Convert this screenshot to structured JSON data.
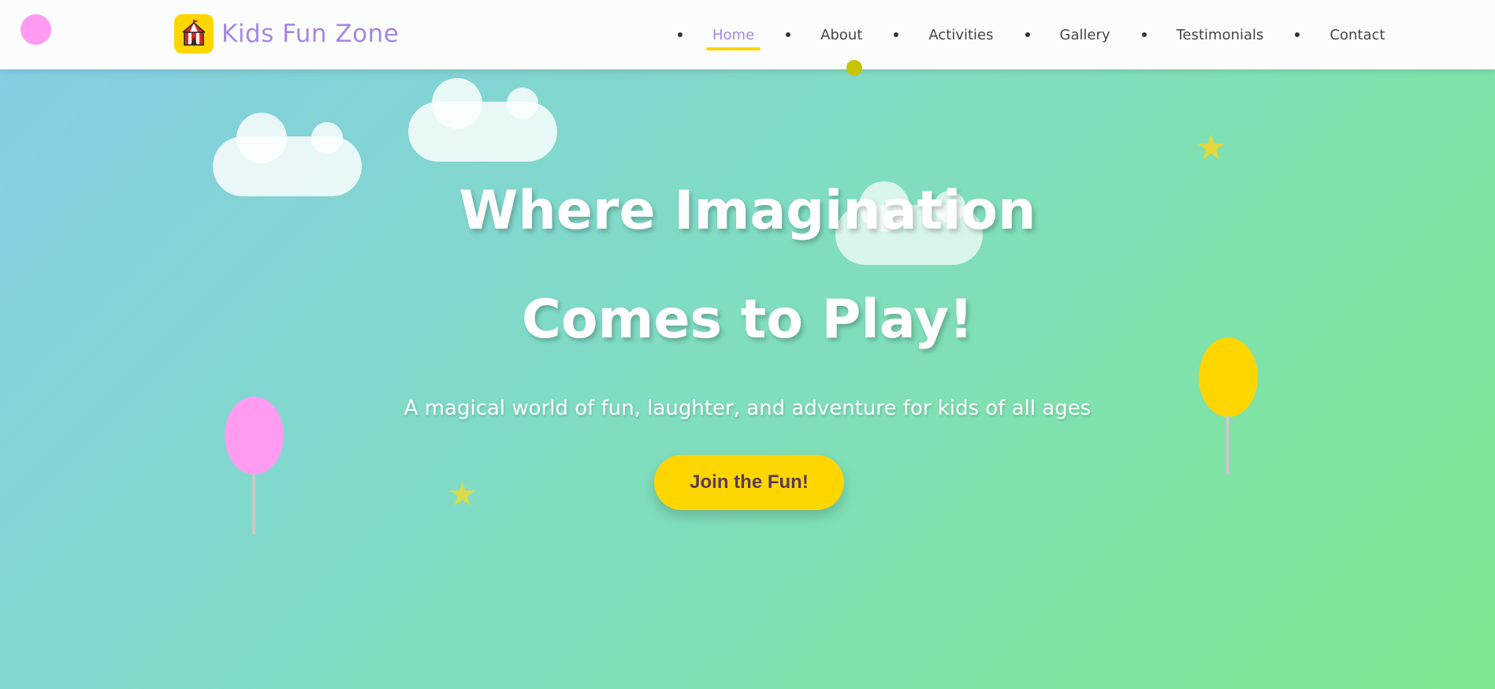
{
  "brand": {
    "name": "Kids Fun Zone",
    "logo_icon": "circus-tent-icon",
    "logo_bg_color": "#ffd600",
    "text_color": "#a488e3"
  },
  "nav": {
    "items": [
      {
        "label": "Home",
        "active": true
      },
      {
        "label": "About",
        "active": false
      },
      {
        "label": "Activities",
        "active": false
      },
      {
        "label": "Gallery",
        "active": false
      },
      {
        "label": "Testimonials",
        "active": false
      },
      {
        "label": "Contact",
        "active": false
      }
    ],
    "active_color": "#a488e3",
    "underline_color": "#ffd600"
  },
  "hero": {
    "title_line_1": "Where Imagination",
    "title_line_2": "Comes to Play!",
    "subtitle": "A magical world of fun, laughter, and adventure for kids of all ages",
    "cta_label": "Join the Fun!",
    "cta_color": "#ffd600"
  },
  "decorations": {
    "balloon_colors": [
      "#ff9cf2",
      "#ffd600"
    ],
    "star_glyph": "★",
    "star_color": "#e6d83a",
    "cloud_color": "#ffffff"
  },
  "colors": {
    "gradient_start": "#85cce6",
    "gradient_end": "#7ee88f",
    "header_bg": "#fbfdfd"
  }
}
